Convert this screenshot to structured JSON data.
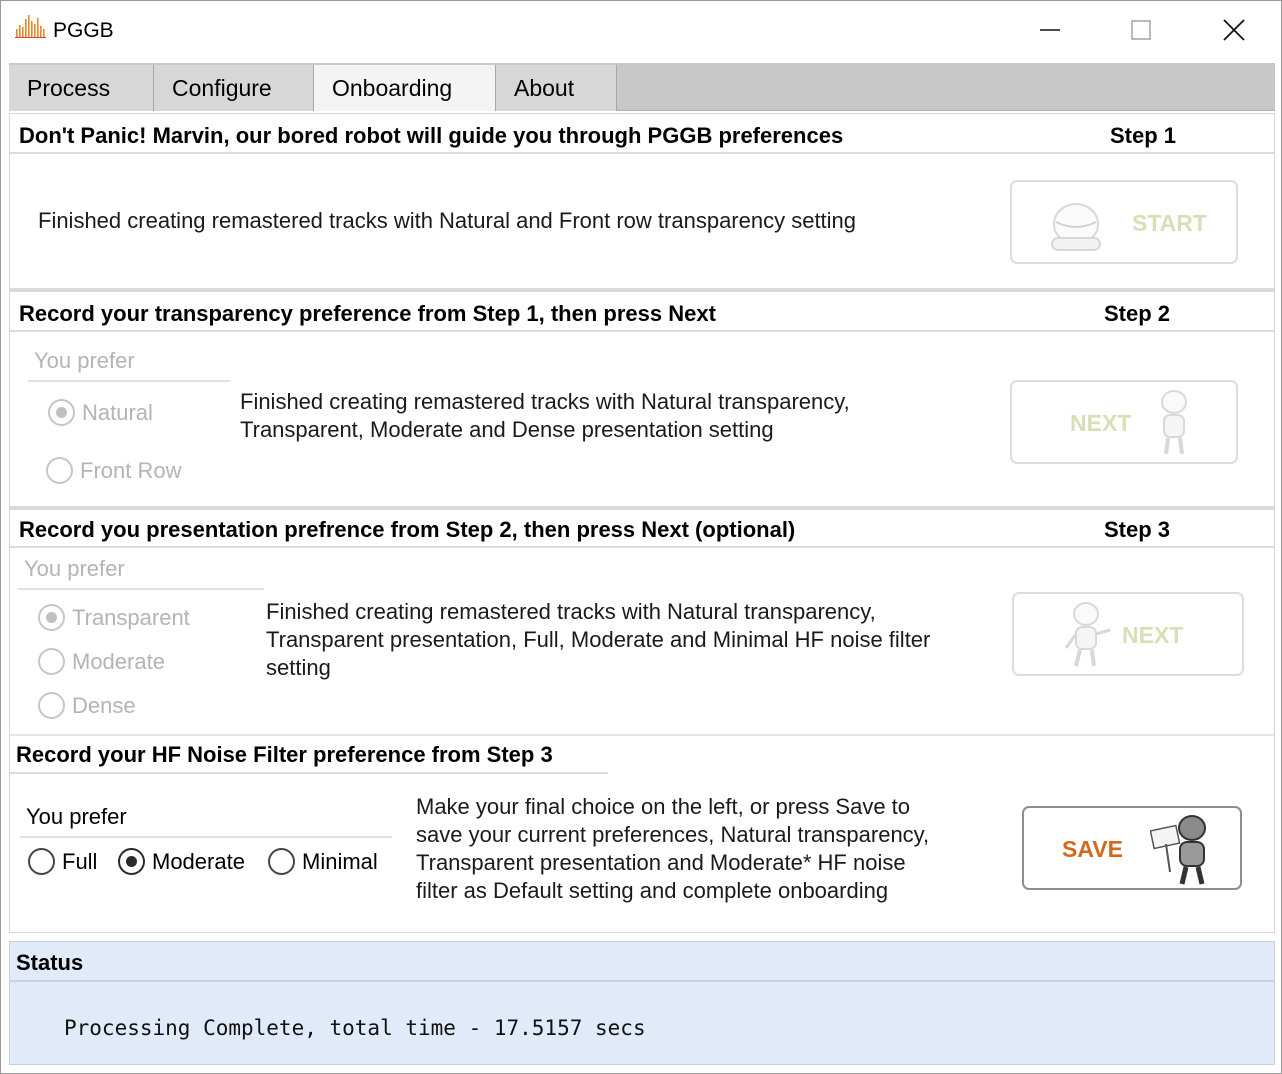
{
  "window": {
    "title": "PGGB",
    "logo_icon": "pggb-waveform-logo-icon"
  },
  "tabs": [
    {
      "label": "Process"
    },
    {
      "label": "Configure"
    },
    {
      "label": "Onboarding",
      "selected": true
    },
    {
      "label": "About"
    }
  ],
  "step1": {
    "title": "Don't Panic! Marvin, our bored robot will guide you through PGGB preferences",
    "step": "Step 1",
    "message": "Finished creating remastered tracks with Natural and Front row  transparency setting",
    "button_label": "START",
    "button_icon": "robot-head-icon"
  },
  "step2": {
    "title": "Record your transparency  preference  from Step 1, then press Next",
    "step": "Step 2",
    "prefer_label": "You prefer",
    "options": [
      "Natural",
      "Front Row"
    ],
    "selected": "Natural",
    "message_line1": "Finished creating remastered tracks with Natural transparency,",
    "message_line2": "Transparent, Moderate and Dense presentation setting",
    "button_label": "NEXT",
    "button_icon": "robot-standing-icon"
  },
  "step3": {
    "title": "Record you presentation prefrence from Step 2, then press Next (optional)",
    "step": "Step 3",
    "prefer_label": "You prefer",
    "options": [
      "Transparent",
      "Moderate",
      "Dense"
    ],
    "selected": "Transparent",
    "message_line1": "Finished creating remastered tracks with Natural transparency,",
    "message_line2": "Transparent presentation, Full, Moderate and Minimal HF noise filter",
    "message_line3": "setting",
    "button_label": "NEXT",
    "button_icon": "robot-pointing-icon"
  },
  "step4": {
    "title": "Record your HF Noise Filter preference from Step 3",
    "prefer_label": "You prefer",
    "options": [
      "Full",
      "Moderate",
      "Minimal"
    ],
    "selected": "Moderate",
    "message_line1": "Make your final choice on the left, or press Save to",
    "message_line2": "save your current preferences, Natural transparency,",
    "message_line3": "Transparent presentation and Moderate* HF noise",
    "message_line4": "filter  as Default setting and complete onboarding",
    "button_label": "SAVE",
    "button_icon": "robot-with-sign-icon"
  },
  "status": {
    "title": "Status",
    "message": "Processing Complete, total time - 17.5157 secs"
  },
  "colors": {
    "status_bg": "#e0eaf9",
    "save_label": "#d2691e",
    "disabled_label": "#d7dfb6",
    "tab_bar": "#c8c8c8",
    "tab_selected": "#f4f4f4"
  }
}
